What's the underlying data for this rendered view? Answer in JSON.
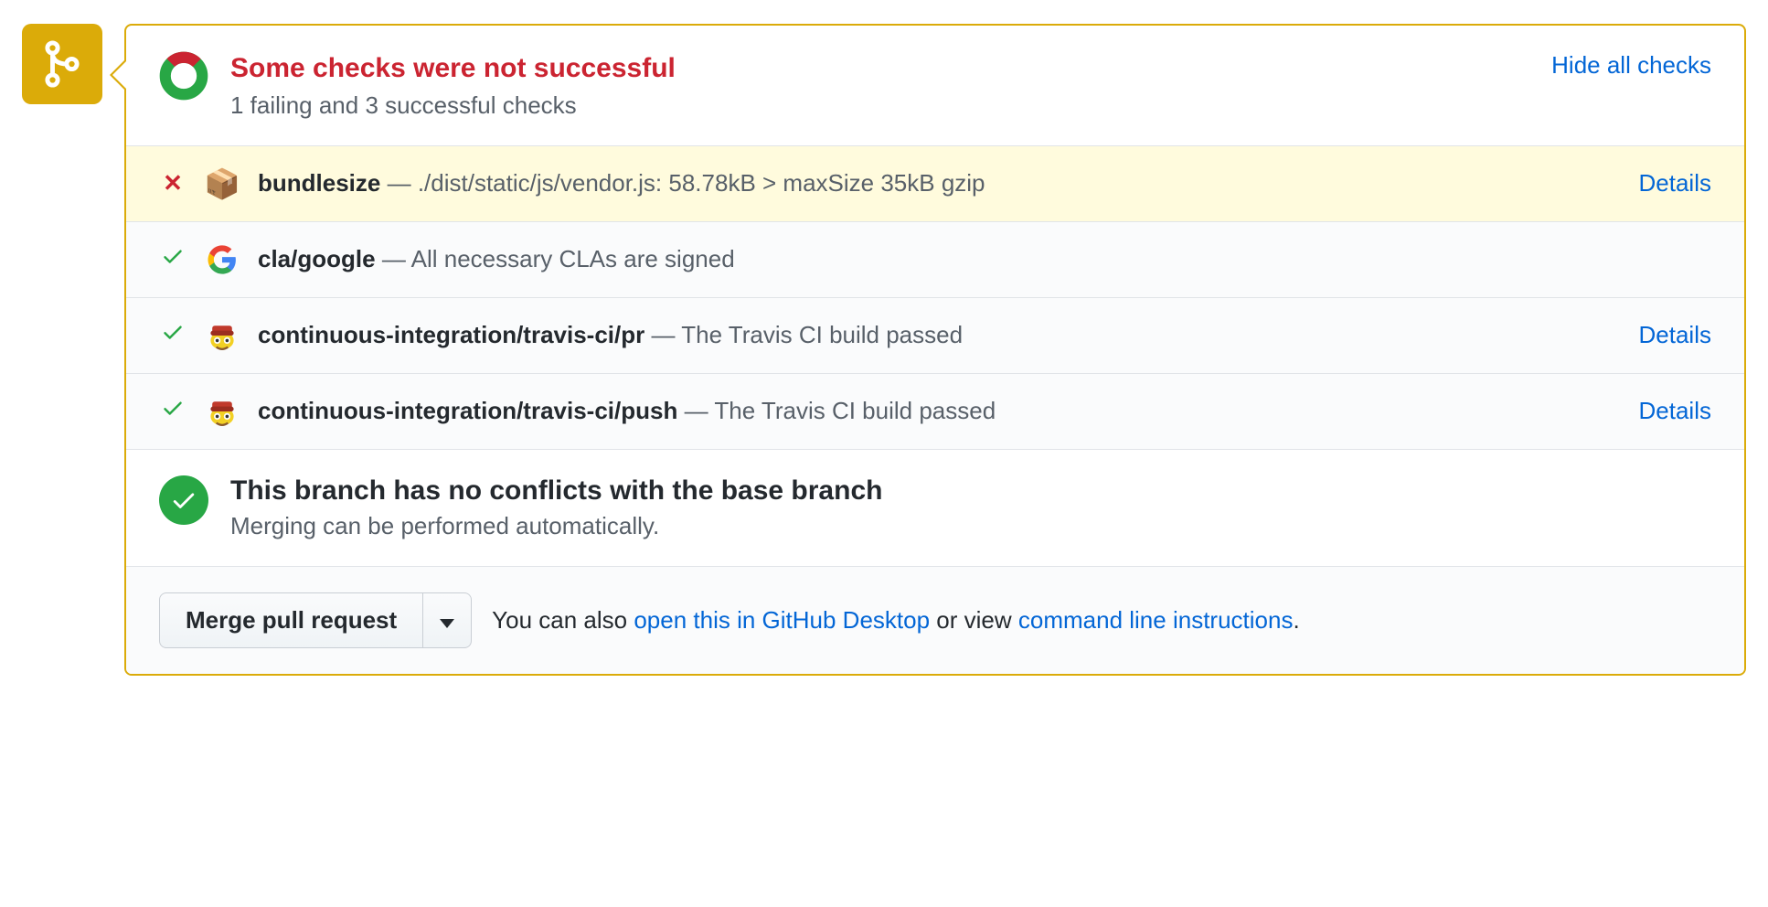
{
  "header": {
    "title": "Some checks were not successful",
    "subtitle": "1 failing and 3 successful checks",
    "toggle_label": "Hide all checks"
  },
  "checks": [
    {
      "status": "fail",
      "icon": "package",
      "name": "bundlesize",
      "desc": "./dist/static/js/vendor.js: 58.78kB > maxSize 35kB gzip",
      "details_label": "Details",
      "has_details": true
    },
    {
      "status": "pass",
      "icon": "google",
      "name": "cla/google",
      "desc": "All necessary CLAs are signed",
      "has_details": false
    },
    {
      "status": "pass",
      "icon": "travis",
      "name": "continuous-integration/travis-ci/pr",
      "desc": "The Travis CI build passed",
      "details_label": "Details",
      "has_details": true
    },
    {
      "status": "pass",
      "icon": "travis",
      "name": "continuous-integration/travis-ci/push",
      "desc": "The Travis CI build passed",
      "details_label": "Details",
      "has_details": true
    }
  ],
  "conflicts": {
    "title": "This branch has no conflicts with the base branch",
    "subtitle": "Merging can be performed automatically."
  },
  "footer": {
    "merge_label": "Merge pull request",
    "text_prefix": "You can also ",
    "link1": "open this in GitHub Desktop",
    "text_mid": " or view ",
    "link2": "command line instructions",
    "text_suffix": "."
  }
}
